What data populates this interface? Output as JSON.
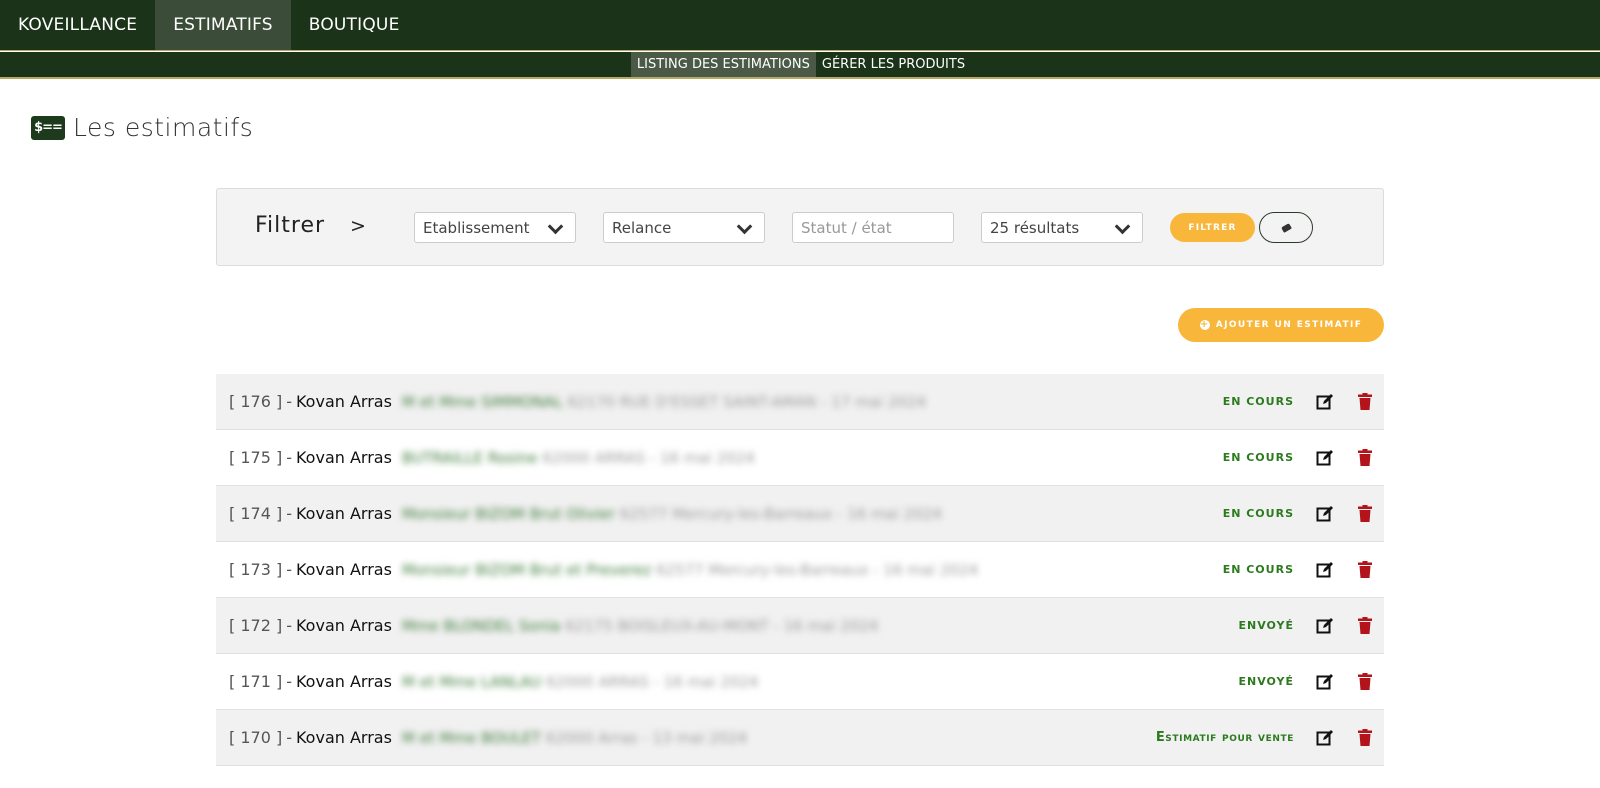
{
  "nav": {
    "items": [
      {
        "label": "KOVEILLANCE",
        "active": false
      },
      {
        "label": "ESTIMATIFS",
        "active": true
      },
      {
        "label": "BOUTIQUE",
        "active": false
      }
    ],
    "sub_items": [
      {
        "label": "LISTING DES ESTIMATIONS",
        "active": true
      },
      {
        "label": "GÉRER LES PRODUITS",
        "active": false
      }
    ]
  },
  "page": {
    "icon_label": "$==",
    "title": "Les estimatifs"
  },
  "filter": {
    "label": "Filtrer",
    "arrow": ">",
    "etablissement": "Etablissement",
    "relance": "Relance",
    "statut_placeholder": "Statut / état",
    "results": "25 résultats",
    "filter_button": "FILTRER"
  },
  "add_button": "AJOUTER UN ESTIMATIF",
  "rows": [
    {
      "id": "[ 176 ]",
      "name": "Kovan Arras",
      "client": "M et Mme SIMMONAL",
      "details": "62170 RUE D'ESSET SAINT-AMAN - 17 mai 2024",
      "status": "EN COURS"
    },
    {
      "id": "[ 175 ]",
      "name": "Kovan Arras",
      "client": "BUTRAILLE Rosine",
      "details": "62000 ARRAS - 16 mai 2024",
      "status": "EN COURS"
    },
    {
      "id": "[ 174 ]",
      "name": "Kovan Arras",
      "client": "Monsieur BIZOM Brut Olivier",
      "details": "62577 Mercury-les-Barreaux - 16 mai 2024",
      "status": "EN COURS"
    },
    {
      "id": "[ 173 ]",
      "name": "Kovan Arras",
      "client": "Monsieur BIZOM Brut et Preverez",
      "details": "62577 Mercury-les-Barreaux - 16 mai 2024",
      "status": "EN COURS"
    },
    {
      "id": "[ 172 ]",
      "name": "Kovan Arras",
      "client": "Mme BLONDEL Sonia",
      "details": "62175 BOISLEUX-AU-MONT - 16 mai 2024",
      "status": "ENVOYÉ"
    },
    {
      "id": "[ 171 ]",
      "name": "Kovan Arras",
      "client": "M et Mme LANLAU",
      "details": "62000 ARRAS - 16 mai 2024",
      "status": "ENVOYÉ"
    },
    {
      "id": "[ 170 ]",
      "name": "Kovan Arras",
      "client": "M et Mme BOULET",
      "details": "62000 Arras - 13 mai 2024",
      "status": "Estimatif pour vente"
    }
  ],
  "colors": {
    "nav_bg": "#1b3318",
    "accent": "#f8b73b",
    "status_green": "#2c7a1e",
    "trash_red": "#b3141b"
  }
}
